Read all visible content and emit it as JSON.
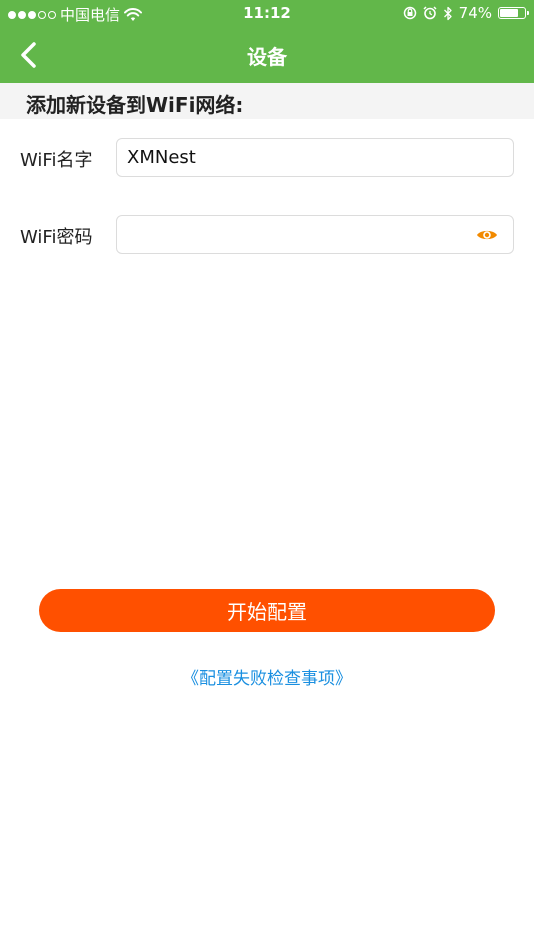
{
  "status_bar": {
    "carrier": "中国电信",
    "time": "11:12",
    "battery_percent": "74%",
    "battery_level": 0.74,
    "signal_bars_filled": 3,
    "signal_bars_total": 5
  },
  "nav": {
    "title": "设备",
    "back_icon": "chevron-left-icon"
  },
  "section": {
    "title": "添加新设备到WiFi网络:"
  },
  "form": {
    "wifi_name_label": "WiFi名字",
    "wifi_name_value": "XMNest",
    "wifi_password_label": "WiFi密码",
    "wifi_password_value": "",
    "eye_icon": "eye-icon"
  },
  "actions": {
    "start_button_label": "开始配置",
    "help_link": "《配置失败检查事项》"
  },
  "colors": {
    "header_green": "#62b74a",
    "button_orange": "#ff5000",
    "link_blue": "#1a8fe0",
    "eye_orange": "#f28a00"
  }
}
